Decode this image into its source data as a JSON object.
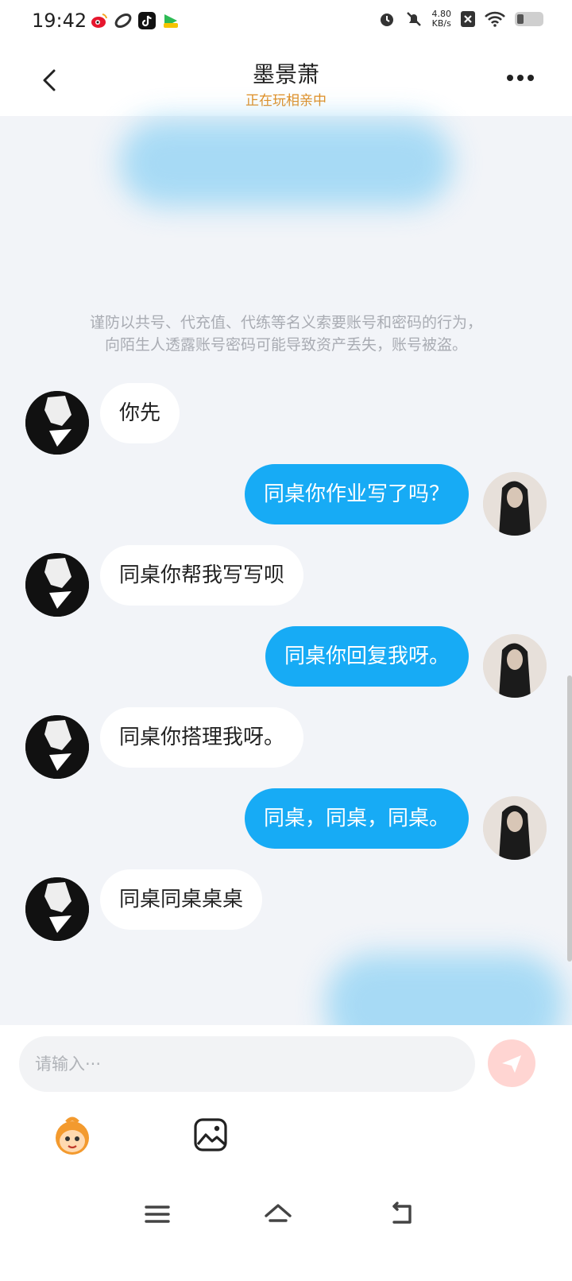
{
  "status_bar": {
    "time": "19:42",
    "net_speed_value": "4.80",
    "net_speed_unit": "KB/s",
    "app_icons": [
      "weibo-icon",
      "link-icon",
      "tiktok-icon",
      "game-icon"
    ]
  },
  "header": {
    "title": "墨景萧",
    "status": "正在玩相亲中"
  },
  "notice": {
    "line1": "谨防以共号、代充值、代练等名义索要账号和密码的行为，",
    "line2": "向陌生人透露账号密码可能导致资产丢失，账号被盗。"
  },
  "messages": [
    {
      "side": "left",
      "text": "你先"
    },
    {
      "side": "right",
      "text": "同桌你作业写了吗？"
    },
    {
      "side": "left",
      "text": "同桌你帮我写写呗"
    },
    {
      "side": "right",
      "text": "同桌你回复我呀。"
    },
    {
      "side": "left",
      "text": "同桌你搭理我呀。"
    },
    {
      "side": "right",
      "text": "同桌，同桌，同桌。"
    },
    {
      "side": "left",
      "text": "同桌同桌桌桌"
    }
  ],
  "input": {
    "placeholder": "请输入···"
  },
  "colors": {
    "accent": "#17abf5",
    "status_orange": "#e08a1a",
    "notice_gray": "#a9acb3",
    "send_button": "#ffd5d2"
  }
}
